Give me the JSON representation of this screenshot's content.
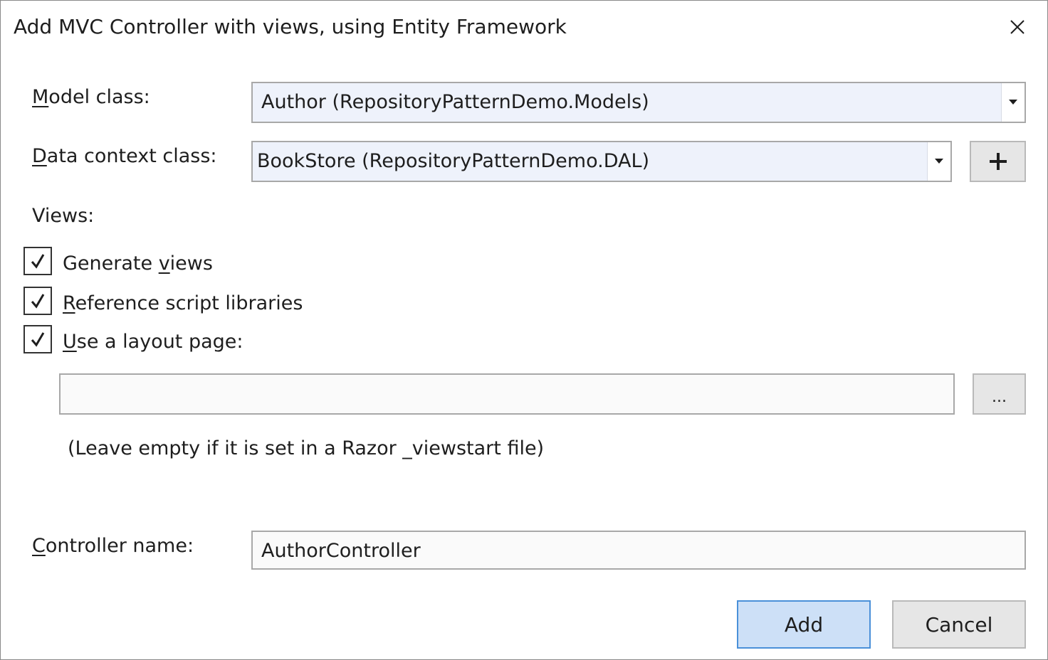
{
  "dialog": {
    "title": "Add MVC Controller with views, using Entity Framework",
    "close_icon": "close-icon"
  },
  "model_class": {
    "label_mnemonic": "M",
    "label_rest": "odel class:",
    "value": "Author (RepositoryPatternDemo.Models)"
  },
  "data_context_class": {
    "label_mnemonic": "D",
    "label_rest": "ata context class:",
    "value": "BookStore (RepositoryPatternDemo.DAL)",
    "add_button_icon": "plus-icon"
  },
  "views": {
    "heading": "Views:",
    "generate_views": {
      "checked": true,
      "label_pre": "Generate ",
      "label_mnemonic": "v",
      "label_post": "iews"
    },
    "reference_script_libraries": {
      "checked": true,
      "label_mnemonic": "R",
      "label_post": "eference script libraries"
    },
    "use_layout_page": {
      "checked": true,
      "label_mnemonic": "U",
      "label_post": "se a layout page:"
    },
    "layout_page_path": {
      "value": "",
      "browse_label": "..."
    },
    "hint": "(Leave empty if it is set in a Razor _viewstart file)"
  },
  "controller_name": {
    "label_mnemonic": "C",
    "label_rest": "ontroller name:",
    "value": "AuthorController"
  },
  "footer": {
    "add_label": "Add",
    "cancel_label": "Cancel"
  },
  "colors": {
    "primary_button_bg": "#cde0f7",
    "primary_button_border": "#4a90d9",
    "combo_bg": "#eef2fb"
  }
}
